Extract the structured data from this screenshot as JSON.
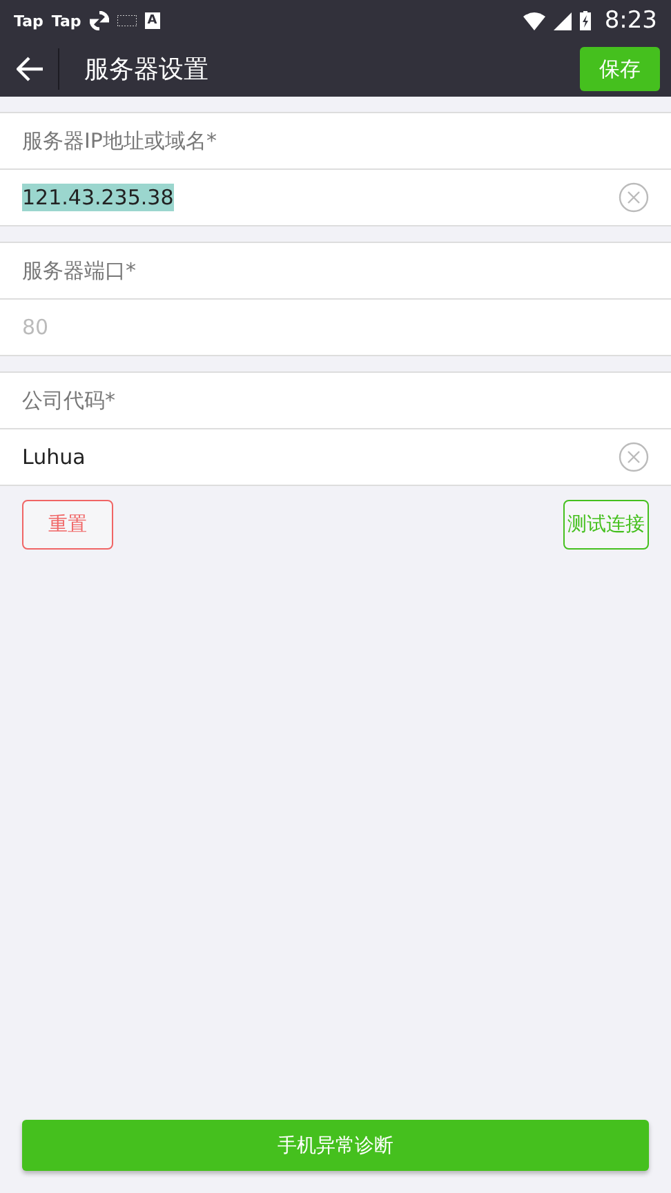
{
  "status_bar": {
    "notifications": [
      {
        "kind": "text",
        "label": "Tap"
      },
      {
        "kind": "text",
        "label": "Tap"
      },
      {
        "kind": "sync"
      },
      {
        "kind": "keyboard"
      },
      {
        "kind": "badge",
        "label": "A"
      }
    ],
    "time": "8:23"
  },
  "toolbar": {
    "title": "服务器设置",
    "save_button": "保存"
  },
  "fields": [
    {
      "label": "服务器IP地址或域名*",
      "value": "121.43.235.38",
      "selected": true,
      "clearable": true
    },
    {
      "label": "服务器端口*",
      "placeholder": "80",
      "selected": false,
      "clearable": false
    },
    {
      "label": "公司代码*",
      "value": "Luhua",
      "selected": false,
      "clearable": true
    }
  ],
  "reset_button": "重置",
  "test_button": "测试连接",
  "diagnose_button": "手机异常诊断"
}
